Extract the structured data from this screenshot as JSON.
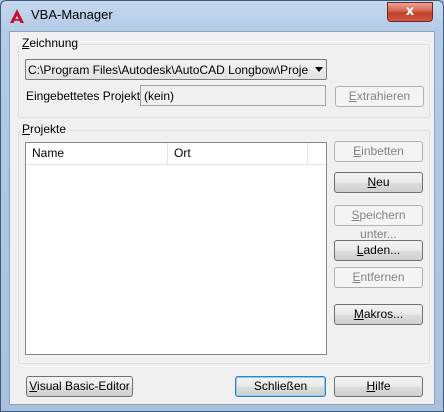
{
  "window": {
    "title": "VBA-Manager",
    "close_glyph": "x"
  },
  "drawing": {
    "group_label_u": "Z",
    "group_label_rest": "eichnung",
    "path_value": "C:\\Program Files\\Autodesk\\AutoCAD Longbow\\Project_A",
    "embedded_label": "Eingebettetes Projekt:",
    "embedded_value": "(kein)",
    "extract_u": "E",
    "extract_rest": "xtrahieren"
  },
  "projects": {
    "group_label_u": "P",
    "group_label_rest": "rojekte",
    "columns": [
      "Name",
      "Ort"
    ],
    "rows": []
  },
  "buttons": {
    "embed_u": "E",
    "embed_rest": "inbetten",
    "new_pre": "",
    "new_u": "N",
    "new_rest": "eu",
    "save_as_u": "S",
    "save_as_rest": "peichern unter...",
    "load_u": "L",
    "load_rest": "aden...",
    "remove_u": "E",
    "remove_rest": "ntfernen",
    "macros_u": "M",
    "macros_rest": "akros...",
    "vbe_u": "V",
    "vbe_rest": "isual Basic-Editor",
    "close": "Schließen",
    "help_u": "H",
    "help_rest": "ilfe"
  },
  "icons": {
    "app": "autocad-a-icon",
    "dropdown": "chevron-down-icon"
  },
  "colors": {
    "titlebar": "#b4cbe6",
    "close_button": "#c0402c",
    "app_icon": "#c8102e"
  }
}
